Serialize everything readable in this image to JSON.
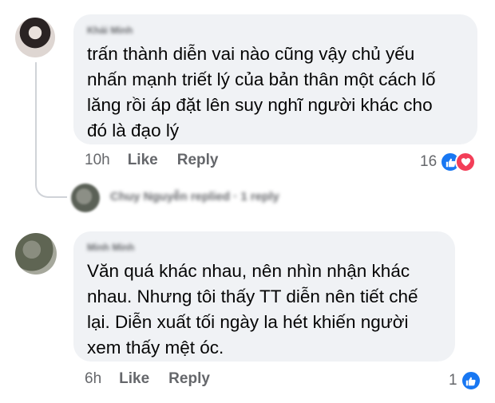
{
  "comments": [
    {
      "author": "Khải Minh",
      "text": "trấn thành diễn vai nào cũng vậy chủ yếu\nnhấn mạnh triết lý của bản thân một cách lố\nlăng rồi áp đặt lên suy nghĩ người khác cho\nđó là đạo lý",
      "time": "10h",
      "like_label": "Like",
      "reply_label": "Reply",
      "reaction_count": "16",
      "reactions": [
        "like-icon",
        "love-icon"
      ]
    },
    {
      "author": "Minh Minh",
      "text": "Văn quá khác nhau, nên nhìn nhận khác\nnhau. Nhưng tôi thấy TT diễn nên tiết chế\nlại. Diễn xuất tối ngày la hét khiến người\nxem thấy mệt óc.",
      "time": "6h",
      "like_label": "Like",
      "reply_label": "Reply",
      "reaction_count": "1",
      "reactions": [
        "like-icon"
      ]
    }
  ],
  "reply_summary": "Chuy Nguyễn replied · 1 reply",
  "colors": {
    "bubble": "#f0f2f5",
    "meta_text": "#65676b",
    "like": "#1877f2",
    "love": "#f33e58"
  }
}
